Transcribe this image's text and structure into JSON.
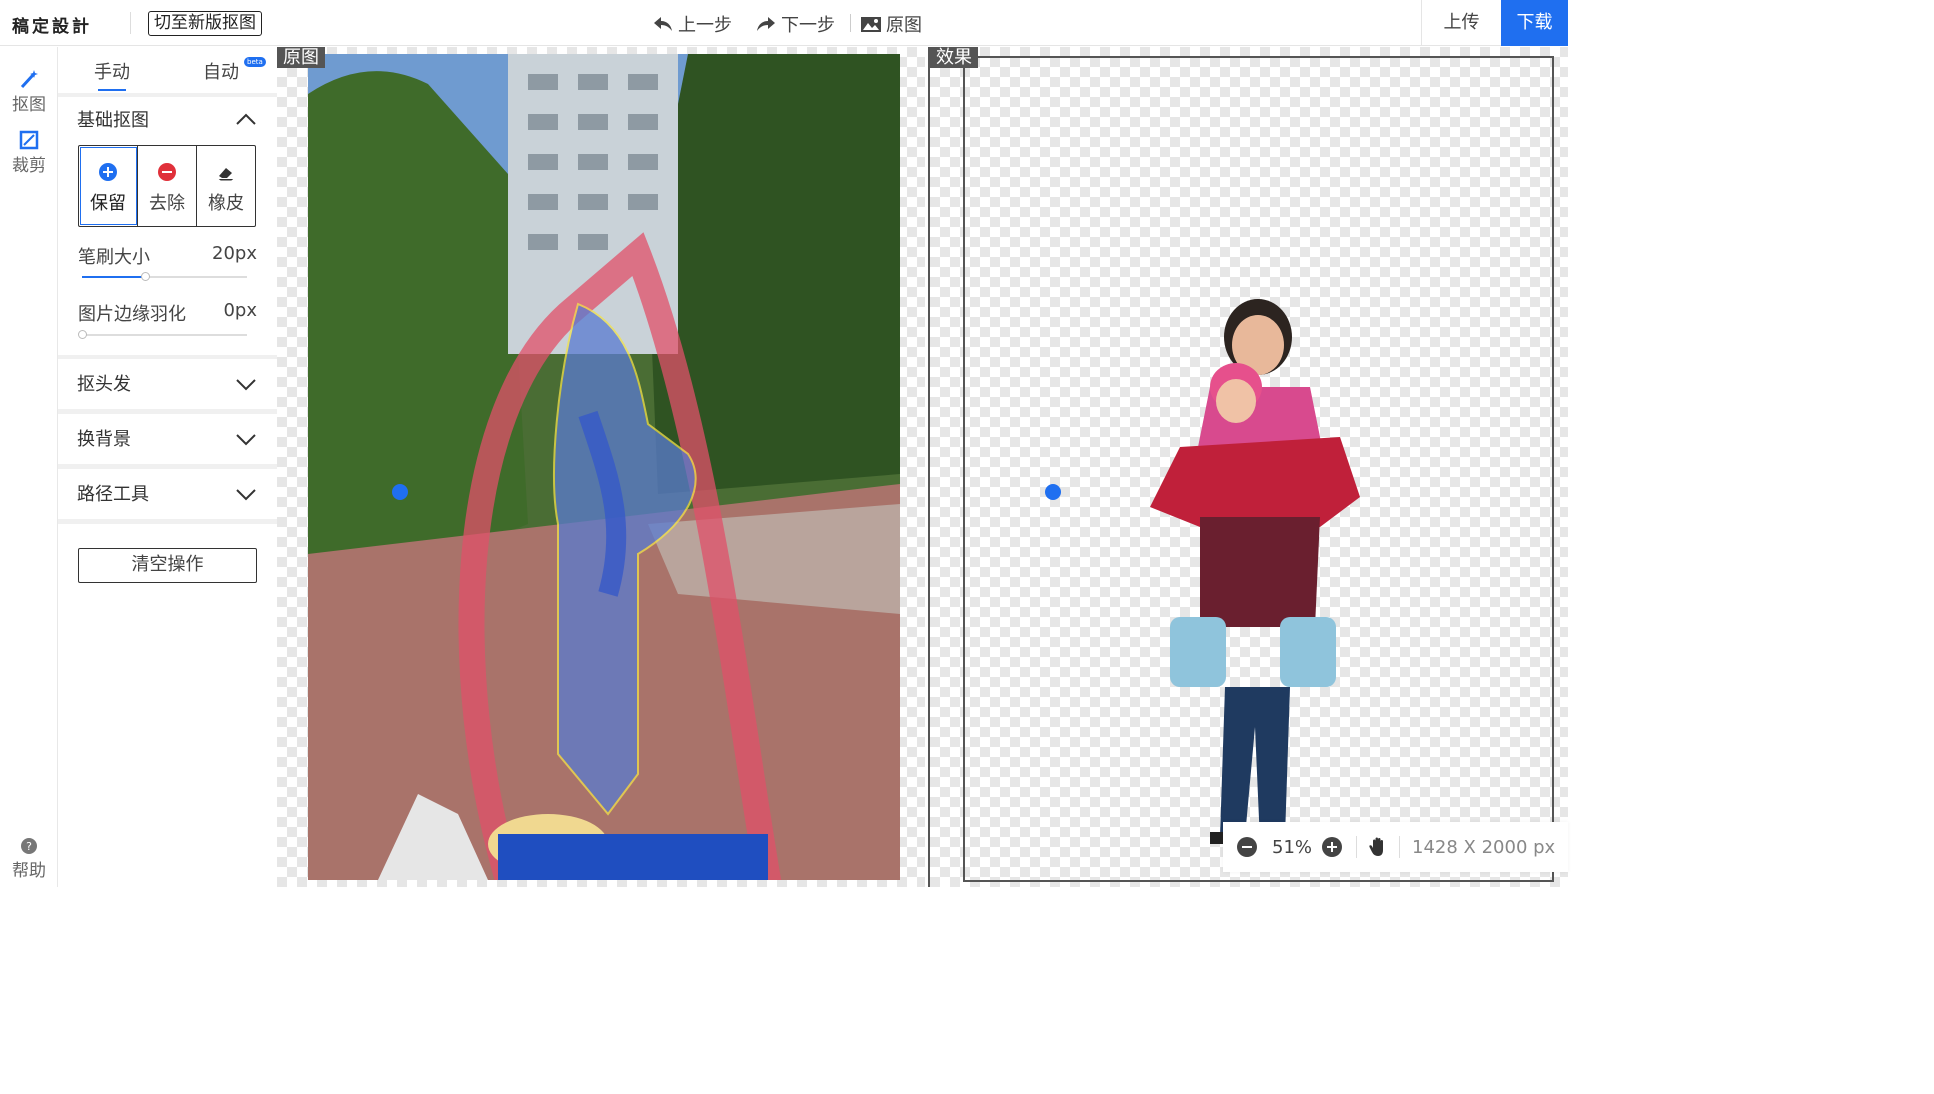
{
  "header": {
    "logo": "稿定設計",
    "switch_label": "切至新版抠图",
    "undo": "上一步",
    "redo": "下一步",
    "original": "原图",
    "upload": "上传",
    "download": "下载"
  },
  "rail": {
    "cutout": "抠图",
    "crop": "裁剪",
    "help": "帮助"
  },
  "panel": {
    "tabs": {
      "manual": "手动",
      "auto": "自动",
      "badge": "beta"
    },
    "basic_title": "基础抠图",
    "tools": {
      "keep": "保留",
      "remove": "去除",
      "eraser": "橡皮"
    },
    "brush_label": "笔刷大小",
    "brush_value": "20px",
    "brush_level": 0.38,
    "feather_label": "图片边缘羽化",
    "feather_value": "0px",
    "feather_level": 0,
    "hair": "抠头发",
    "background": "换背景",
    "path": "路径工具",
    "clear": "清空操作"
  },
  "canvas": {
    "original_label": "原图",
    "result_label": "效果",
    "zoom": "51%",
    "size": "1428 X 2000 px"
  },
  "colors": {
    "accent": "#1f6ff0",
    "keep": "#1f6ff0",
    "remove": "#e0303a"
  }
}
